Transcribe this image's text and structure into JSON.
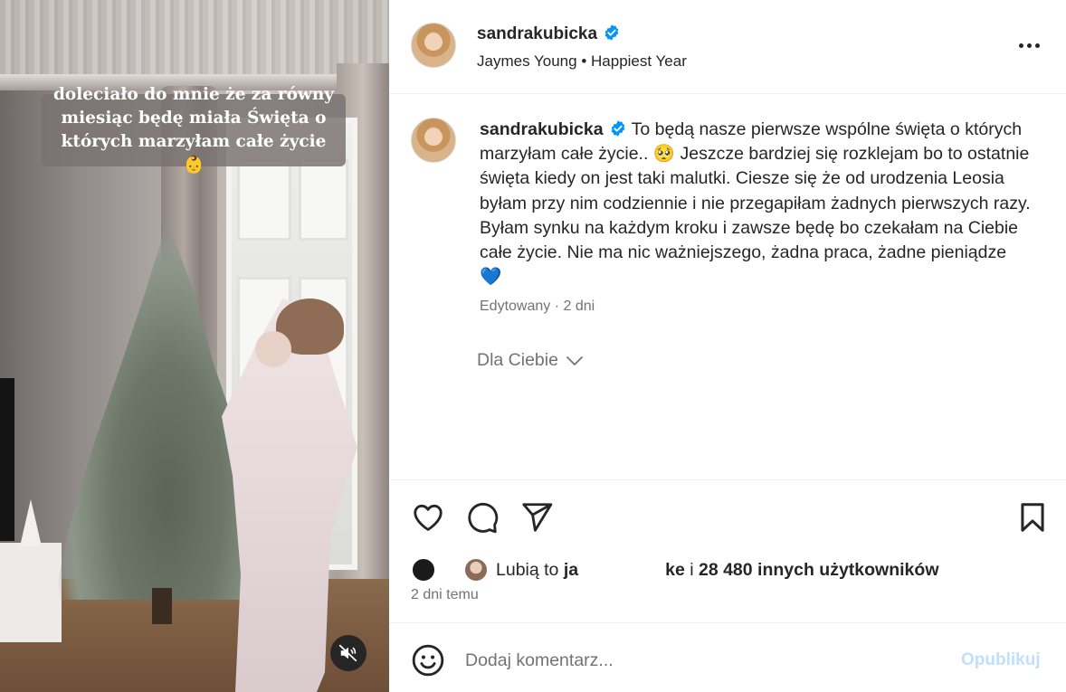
{
  "media": {
    "overlay_caption": "doleciało do mnie że za równy\nmiesiąc będę miała Święta o\nktórych marzyłam całe życie 👶",
    "mute_icon": "speaker-muted-icon"
  },
  "header": {
    "username": "sandrakubicka",
    "verified": true,
    "audio_artist": "Jaymes Young",
    "audio_separator": "•",
    "audio_track": "Happiest Year",
    "more_icon": "more-options-icon"
  },
  "caption": {
    "username": "sandrakubicka",
    "text": "To będą nasze pierwsze wspólne święta o których marzyłam całe życie.. 🥺 Jeszcze bardziej się rozklejam bo to ostatnie święta kiedy on jest taki malutki. Ciesze się że od urodzenia Leosia byłam przy nim codziennie i nie przegapiłam żadnych pierwszych razy. Byłam synku na każdym kroku i zawsze będę bo czekałam na Ciebie całe życie. Nie ma nic ważniejszego, żadna praca, żadne pieniądze 💙",
    "edited_label": "Edytowany",
    "dot": "·",
    "age": "2 dni"
  },
  "for_you": {
    "label": "Dla Ciebie"
  },
  "likes": {
    "prefix": "Lubią to",
    "name_start": "ja",
    "name_end": "ke",
    "connector": "i",
    "others": "28 480 innych użytkowników"
  },
  "post_time": "2 dni temu",
  "comment_box": {
    "placeholder": "Dodaj komentarz...",
    "publish_label": "Opublikuj"
  },
  "colors": {
    "verified_blue": "#0095f6",
    "muted_text": "#737373",
    "publish_disabled": "#c0dffd",
    "heart_blue_emoji": "#1e63b6"
  }
}
